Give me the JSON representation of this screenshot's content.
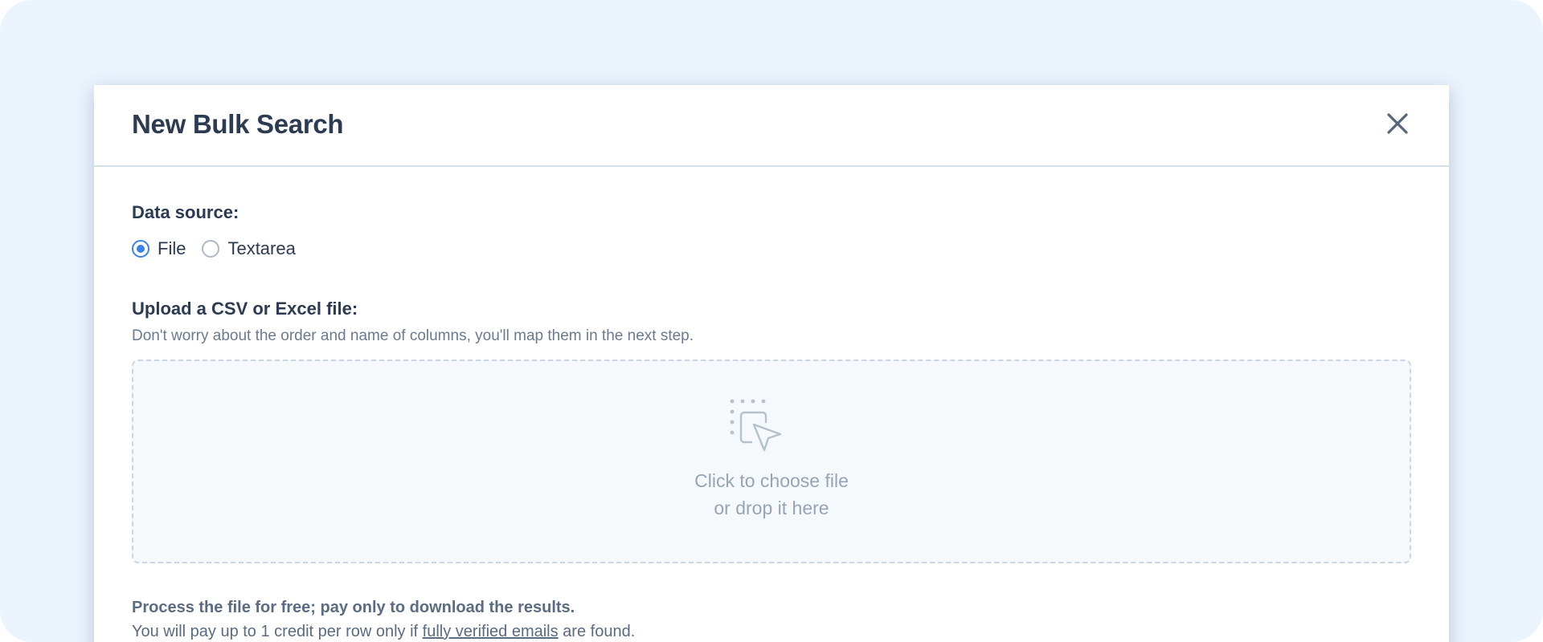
{
  "modal": {
    "title": "New Bulk Search"
  },
  "data_source": {
    "label": "Data source:",
    "options": [
      {
        "label": "File",
        "checked": true
      },
      {
        "label": "Textarea",
        "checked": false
      }
    ]
  },
  "upload": {
    "label": "Upload a CSV or Excel file:",
    "hint": "Don't worry about the order and name of columns, you'll map them in the next step.",
    "dropzone_line1": "Click to choose file",
    "dropzone_line2": "or drop it here"
  },
  "pricing": {
    "headline": "Process the file for free; pay only to download the results.",
    "text_before": "You will pay up to 1 credit per row only if ",
    "link": "fully verified emails",
    "text_after": " are found."
  },
  "icons": {
    "close": "close-icon",
    "dropzone": "click-target-icon"
  },
  "colors": {
    "backdrop": "#ebf3fd",
    "title": "#2d3b52",
    "accent": "#3b82e8",
    "muted": "#97a4b5"
  }
}
